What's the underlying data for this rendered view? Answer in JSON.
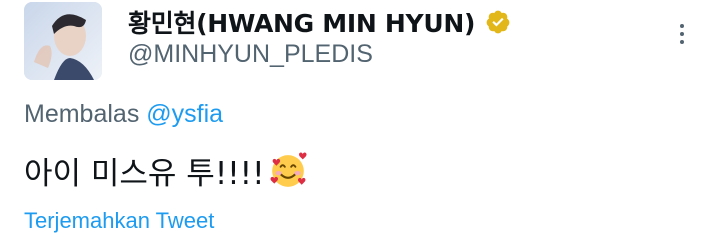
{
  "author": {
    "display_name": "황민현(HWANG MIN HYUN)",
    "handle": "@MINHYUN_PLEDIS",
    "verified": true,
    "verified_badge_color": "#e2b719"
  },
  "reply": {
    "prefix": "Membalas",
    "mention": "@ysfia"
  },
  "tweet": {
    "text": "아이 미스유 투!!!!",
    "emoji": "smiling-face-with-hearts"
  },
  "actions": {
    "translate_label": "Terjemahkan Tweet",
    "more_icon": "more-vertical-icon"
  },
  "colors": {
    "link": "#1d9bf0",
    "secondary_text": "#536471",
    "primary_text": "#0f1419"
  }
}
